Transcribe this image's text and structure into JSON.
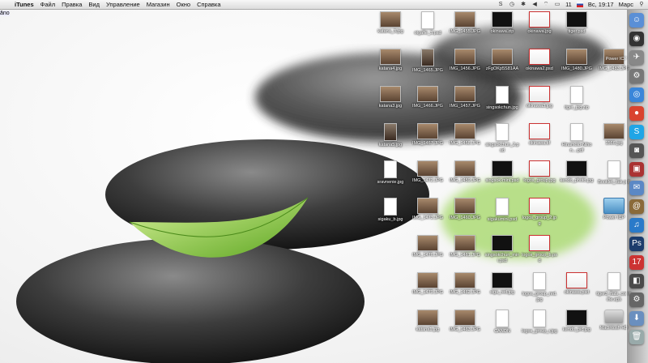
{
  "menubar": {
    "apple": "",
    "app_name": "iTunes",
    "menus": [
      "Файл",
      "Правка",
      "Вид",
      "Управление",
      "Магазин",
      "Окно",
      "Справка"
    ],
    "status": {
      "battery_percent": "11",
      "clock": "Вс, 19:17",
      "user": "Марс"
    }
  },
  "desktop": {
    "selected_label": "āno",
    "icons": [
      {
        "name": "katana_3.jpg",
        "type": "photo"
      },
      {
        "name": "otgafie_3.psd",
        "type": "doc"
      },
      {
        "name": "IMG_1455.JPG",
        "type": "photo"
      },
      {
        "name": "okinawa.zip",
        "type": "dark"
      },
      {
        "name": "okinawa.jpg",
        "type": "red"
      },
      {
        "name": "tiger.psd",
        "type": "dark"
      },
      {
        "name": "katana4.jpg",
        "type": "photo"
      },
      {
        "name": "IMG_1465.JPG",
        "type": "portrait"
      },
      {
        "name": "IMG_1456.JPG",
        "type": "photo"
      },
      {
        "name": "zFgOKp5S81AA",
        "type": "photo"
      },
      {
        "name": "okinawa2.psd",
        "type": "red"
      },
      {
        "name": "IMG_1480.JPG",
        "type": "photo"
      },
      {
        "name": "IMG_1483.JPG",
        "type": "photo"
      },
      {
        "name": "katana3.jpg",
        "type": "photo"
      },
      {
        "name": "IMG_1466.JPG",
        "type": "photo"
      },
      {
        "name": "IMG_1457.JPG",
        "type": "photo"
      },
      {
        "name": "singsokchun.jpg",
        "type": "doc"
      },
      {
        "name": "okinawa3.jpg",
        "type": "red"
      },
      {
        "name": "tiger_jpg.zip",
        "type": "doc"
      },
      {
        "name": "katana5.jpg",
        "type": "portrait"
      },
      {
        "name": "IMG_1467.JPG",
        "type": "photo"
      },
      {
        "name": "IMG_1458.JPG",
        "type": "photo"
      },
      {
        "name": "singsokchun_2.psd",
        "type": "doc"
      },
      {
        "name": "okinawa.tif",
        "type": "red"
      },
      {
        "name": "Hinamoto-Nihon....pdf",
        "type": "doc"
      },
      {
        "name": "1566.jpg",
        "type": "photo"
      },
      {
        "name": "sravnenie.jpg",
        "type": "doc"
      },
      {
        "name": "IMG_1472.JPG",
        "type": "photo"
      },
      {
        "name": "IMG_1459.JPG",
        "type": "photo"
      },
      {
        "name": "singsok-mini.psd",
        "type": "dark"
      },
      {
        "name": "logos_group.jpg",
        "type": "red"
      },
      {
        "name": "kendo_photo.jpg",
        "type": "dark"
      },
      {
        "name": "Booklet_Itak.pdf",
        "type": "doc"
      },
      {
        "name": "sigaku_b.jpg",
        "type": "doc"
      },
      {
        "name": "IMG_1473.JPG",
        "type": "photo"
      },
      {
        "name": "IMG_1460.JPG",
        "type": "photo"
      },
      {
        "name": "sigakumini.psd",
        "type": "doc"
      },
      {
        "name": "logos_group_2.jpg",
        "type": "red"
      },
      {
        "name": "Power ICP",
        "type": "folder"
      },
      {
        "name": "IMG_1476.JPG",
        "type": "photo"
      },
      {
        "name": "IMG_1461.JPG",
        "type": "photo"
      },
      {
        "name": "singsokchun_mini.psd",
        "type": "dark"
      },
      {
        "name": "logos_group_b.psd",
        "type": "red"
      },
      {
        "name": "IMG_1479.JPG",
        "type": "photo"
      },
      {
        "name": "IMG_1462.JPG",
        "type": "photo"
      },
      {
        "name": "siga_red.jpg",
        "type": "dark"
      },
      {
        "name": "logos_group_red.jpg",
        "type": "doc"
      },
      {
        "name": "okinawa.psd",
        "type": "red"
      },
      {
        "name": "tiger3_flats_combine.eps",
        "type": "doc"
      },
      {
        "name": "katana1.jpg",
        "type": "photo"
      },
      {
        "name": "IMG_1463.JPG",
        "type": "photo"
      },
      {
        "name": "CANON",
        "type": "doc"
      },
      {
        "name": "logos_group_r.jpg",
        "type": "doc"
      },
      {
        "name": "kendo_pic.jpg",
        "type": "dark"
      },
      {
        "name": "Macintosh HD",
        "type": "hdd"
      }
    ]
  },
  "dock": {
    "peek_label": "Power ICP",
    "items": [
      {
        "icon": "finder-icon",
        "glyph": "☺",
        "color": "#5a8fd6"
      },
      {
        "icon": "dashboard-icon",
        "glyph": "◉",
        "color": "#333"
      },
      {
        "icon": "launchpad-icon",
        "glyph": "✈",
        "color": "#888"
      },
      {
        "icon": "settings-icon",
        "glyph": "⚙",
        "color": "#777"
      },
      {
        "icon": "safari-icon",
        "glyph": "◎",
        "color": "#3a86d9"
      },
      {
        "icon": "chrome-icon",
        "glyph": "●",
        "color": "#d9432f"
      },
      {
        "icon": "skype-icon",
        "glyph": "S",
        "color": "#1fa5e6"
      },
      {
        "icon": "camera-icon",
        "glyph": "◙",
        "color": "#555"
      },
      {
        "icon": "photobooth-icon",
        "glyph": "▣",
        "color": "#a33"
      },
      {
        "icon": "mail-icon",
        "glyph": "✉",
        "color": "#5b88c5"
      },
      {
        "icon": "address-book-icon",
        "glyph": "@",
        "color": "#8a6a3a"
      },
      {
        "icon": "itunes-icon",
        "glyph": "♫",
        "color": "#2a7ac9"
      },
      {
        "icon": "photoshop-icon",
        "glyph": "Ps",
        "color": "#1c3c6c"
      },
      {
        "icon": "ical-icon",
        "glyph": "17",
        "color": "#c33"
      },
      {
        "icon": "preview-icon",
        "glyph": "◧",
        "color": "#4a4a4a"
      },
      {
        "icon": "system-prefs-icon",
        "glyph": "⚙",
        "color": "#666"
      },
      {
        "icon": "downloads-icon",
        "glyph": "⬇",
        "color": "#6a8fbf"
      },
      {
        "icon": "trash-icon",
        "glyph": "🗑",
        "color": "#9aa"
      }
    ]
  }
}
